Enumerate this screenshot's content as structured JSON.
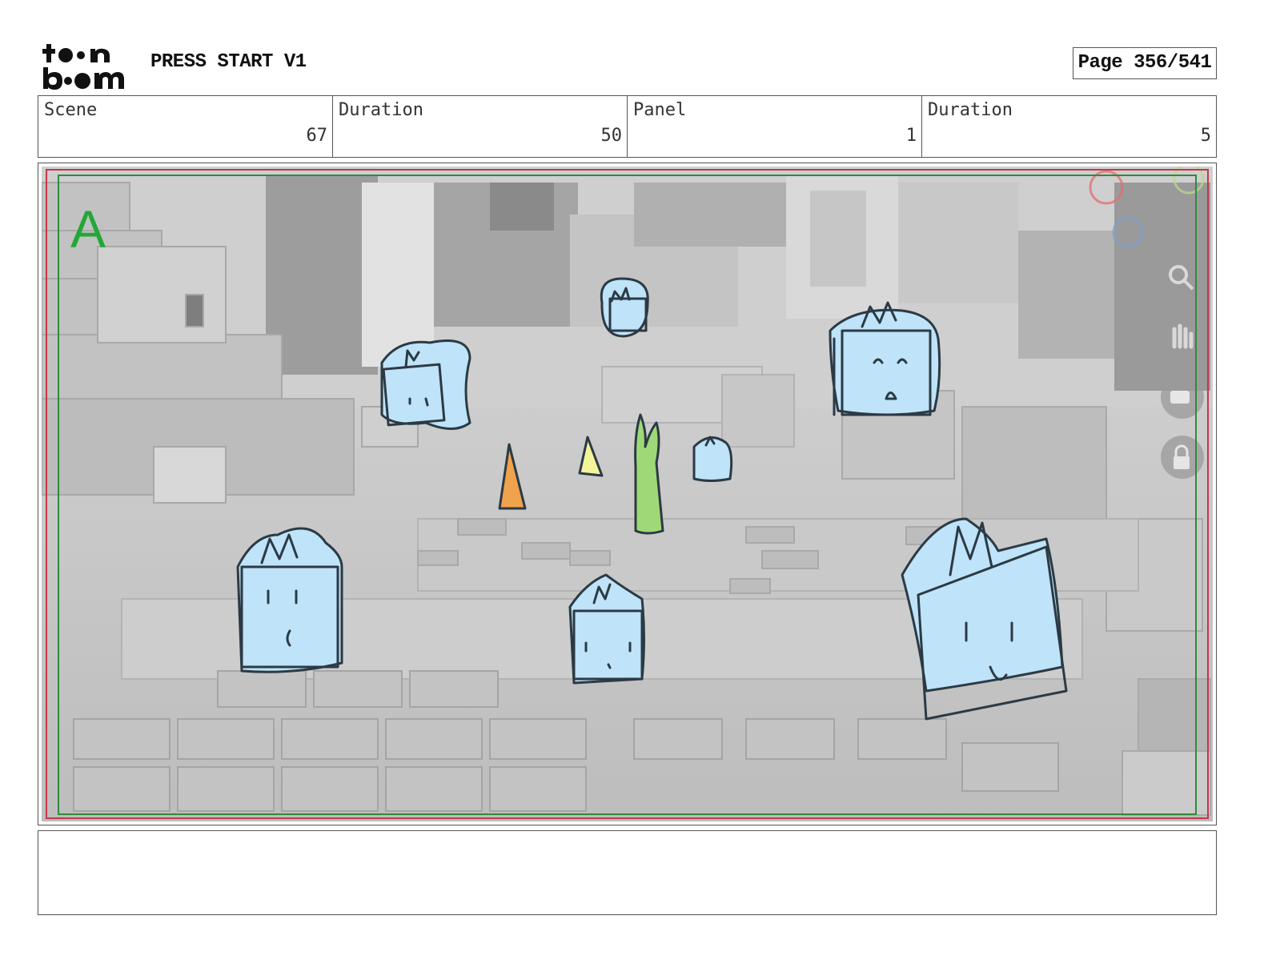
{
  "header": {
    "logo": {
      "top_text": "toon",
      "bottom_text": "boom",
      "icon": "toon-boom-logo"
    },
    "project_title": "PRESS START V1",
    "page_indicator": "Page 356/541"
  },
  "info_table": [
    {
      "label": "Scene",
      "value": "67"
    },
    {
      "label": "Duration",
      "value": "50"
    },
    {
      "label": "Panel",
      "value": "1"
    },
    {
      "label": "Duration",
      "value": "5"
    }
  ],
  "panel": {
    "camera_label": "A",
    "image": "sketch of cube-shaped characters over a grey 3D voxel town",
    "colors": {
      "safe_area": "#2e8b3a",
      "frame_edge": "#c0394b",
      "character_fill": "#bfe3f8",
      "camera_label": "#22a838"
    }
  },
  "notes": {
    "text": ""
  }
}
